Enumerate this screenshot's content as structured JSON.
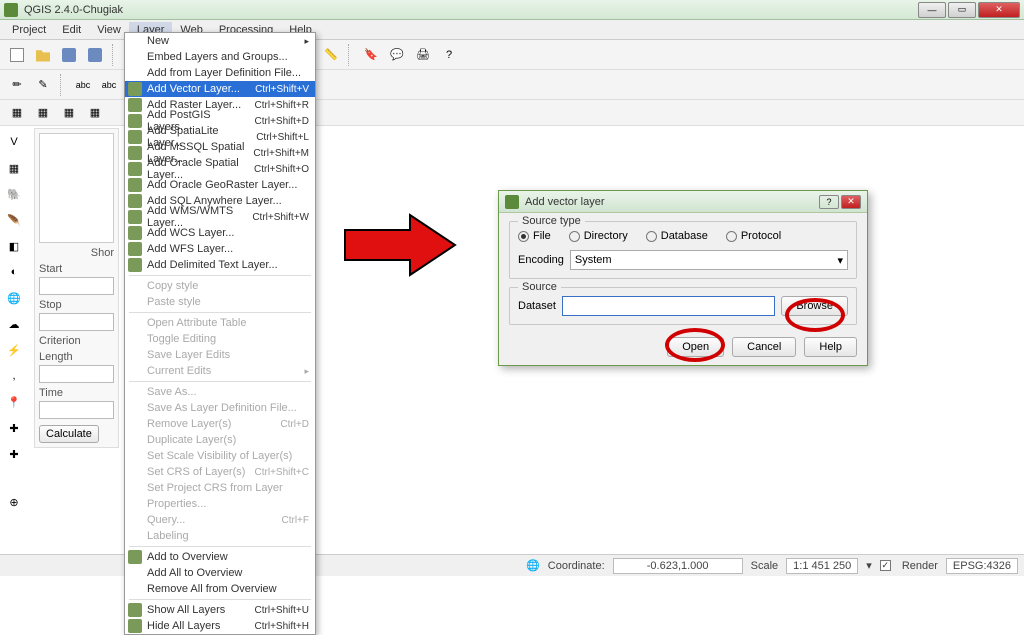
{
  "app": {
    "title": "QGIS 2.4.0-Chugiak"
  },
  "menubar": [
    "Project",
    "Edit",
    "View",
    "Layer",
    "Web",
    "Processing",
    "Help"
  ],
  "menubar_open_index": 3,
  "layer_menu": [
    {
      "label": "New",
      "submenu": true
    },
    {
      "label": "Embed Layers and Groups..."
    },
    {
      "label": "Add from Layer Definition File..."
    },
    {
      "label": "Add Vector Layer...",
      "shortcut": "Ctrl+Shift+V",
      "selected": true,
      "icon": "vector-layer-icon"
    },
    {
      "label": "Add Raster Layer...",
      "shortcut": "Ctrl+Shift+R",
      "icon": "raster-layer-icon"
    },
    {
      "label": "Add PostGIS Layers...",
      "shortcut": "Ctrl+Shift+D",
      "icon": "postgis-icon"
    },
    {
      "label": "Add SpatiaLite Layer...",
      "shortcut": "Ctrl+Shift+L",
      "icon": "spatialite-icon"
    },
    {
      "label": "Add MSSQL Spatial Layer...",
      "shortcut": "Ctrl+Shift+M",
      "icon": "mssql-icon"
    },
    {
      "label": "Add Oracle Spatial Layer...",
      "shortcut": "Ctrl+Shift+O",
      "icon": "oracle-icon"
    },
    {
      "label": "Add Oracle GeoRaster Layer...",
      "icon": "oracle-georaster-icon"
    },
    {
      "label": "Add SQL Anywhere Layer...",
      "icon": "sql-anywhere-icon"
    },
    {
      "label": "Add WMS/WMTS Layer...",
      "shortcut": "Ctrl+Shift+W",
      "icon": "wms-icon"
    },
    {
      "label": "Add WCS Layer...",
      "icon": "wcs-icon"
    },
    {
      "label": "Add WFS Layer...",
      "icon": "wfs-icon"
    },
    {
      "label": "Add Delimited Text Layer...",
      "icon": "delimited-text-icon"
    },
    {
      "sep": true
    },
    {
      "label": "Copy style",
      "disabled": true
    },
    {
      "label": "Paste style",
      "disabled": true
    },
    {
      "sep": true
    },
    {
      "label": "Open Attribute Table",
      "disabled": true
    },
    {
      "label": "Toggle Editing",
      "disabled": true
    },
    {
      "label": "Save Layer Edits",
      "disabled": true
    },
    {
      "label": "Current Edits",
      "submenu": true,
      "disabled": true
    },
    {
      "sep": true
    },
    {
      "label": "Save As...",
      "disabled": true
    },
    {
      "label": "Save As Layer Definition File...",
      "disabled": true
    },
    {
      "label": "Remove Layer(s)",
      "shortcut": "Ctrl+D",
      "disabled": true
    },
    {
      "label": "Duplicate Layer(s)",
      "disabled": true
    },
    {
      "label": "Set Scale Visibility of Layer(s)",
      "disabled": true
    },
    {
      "label": "Set CRS of Layer(s)",
      "shortcut": "Ctrl+Shift+C",
      "disabled": true
    },
    {
      "label": "Set Project CRS from Layer",
      "disabled": true
    },
    {
      "label": "Properties...",
      "disabled": true
    },
    {
      "label": "Query...",
      "shortcut": "Ctrl+F",
      "disabled": true
    },
    {
      "label": "Labeling",
      "disabled": true
    },
    {
      "sep": true
    },
    {
      "label": "Add to Overview",
      "icon": "add-overview-icon"
    },
    {
      "label": "Add All to Overview"
    },
    {
      "label": "Remove All from Overview"
    },
    {
      "sep": true
    },
    {
      "label": "Show All Layers",
      "shortcut": "Ctrl+Shift+U",
      "icon": "show-layers-icon"
    },
    {
      "label": "Hide All Layers",
      "shortcut": "Ctrl+Shift+H",
      "icon": "hide-layers-icon"
    }
  ],
  "sidepanel": {
    "short_label": "Shor",
    "start_label": "Start",
    "stop_label": "Stop",
    "criterion_label": "Criterion",
    "length_label": "Length",
    "time_label": "Time",
    "calculate_label": "Calculate"
  },
  "dialog": {
    "title": "Add vector layer",
    "source_type_label": "Source type",
    "radios": {
      "file": "File",
      "directory": "Directory",
      "database": "Database",
      "protocol": "Protocol"
    },
    "radio_selected": "file",
    "encoding_label": "Encoding",
    "encoding_value": "System",
    "source_label": "Source",
    "dataset_label": "Dataset",
    "dataset_value": "",
    "browse_label": "Browse",
    "open_label": "Open",
    "cancel_label": "Cancel",
    "help_label": "Help"
  },
  "statusbar": {
    "coordinate_label": "Coordinate:",
    "coordinate_value": "-0.623,1.000",
    "scale_label": "Scale",
    "scale_value": "1:1 451 250",
    "render_label": "Render",
    "epsg": "EPSG:4326"
  }
}
